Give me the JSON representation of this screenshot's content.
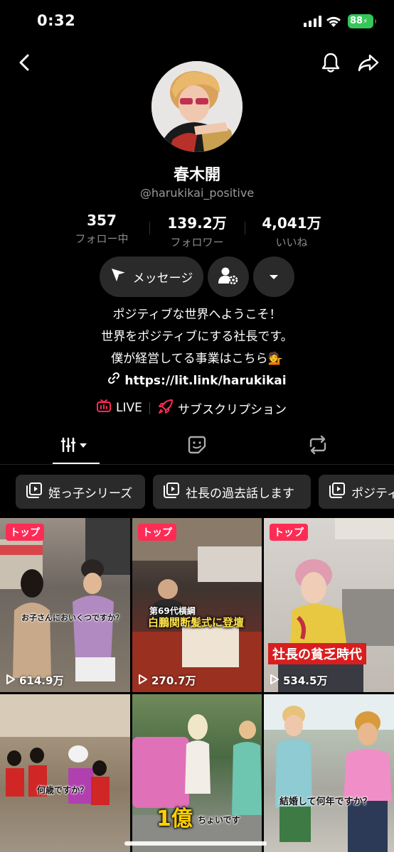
{
  "status_bar": {
    "time": "0:32",
    "battery": "88"
  },
  "profile": {
    "name": "春木開",
    "handle": "@harukikai_positive",
    "stats": [
      {
        "value": "357",
        "label": "フォロー中"
      },
      {
        "value": "139.2万",
        "label": "フォロワー"
      },
      {
        "value": "4,041万",
        "label": "いいね"
      }
    ],
    "message_label": "メッセージ",
    "bio_lines": [
      "ポジティブな世界へようこそ！",
      "世界をポジティブにする社長です。",
      "僕が経営してる事業はこちら💁"
    ],
    "link": "https://lit.link/harukikai",
    "live_label": "LIVE",
    "subscription_label": "サブスクリプション"
  },
  "playlists": [
    "姪っ子シリーズ",
    "社長の過去話します",
    "ポジティ"
  ],
  "videos": [
    {
      "badge": "トップ",
      "views": "614.9万",
      "caption": "お子さんにおいくつですか？"
    },
    {
      "badge": "トップ",
      "views": "270.7万",
      "caption_small": "第69代横綱",
      "caption": "白鵬関断髪式に登壇"
    },
    {
      "badge": "トップ",
      "views": "534.5万",
      "caption": "社長の貧乏時代"
    },
    {
      "badge": "",
      "views": "",
      "caption": "何歳ですか？"
    },
    {
      "badge": "",
      "views": "",
      "caption_big": "1億",
      "caption": "ちょいです"
    },
    {
      "badge": "",
      "views": "",
      "caption": "結婚して何年ですか？"
    }
  ],
  "colors": {
    "accent": "#fe2c55",
    "battery": "#34c759",
    "button_bg": "#2a2a2a"
  }
}
